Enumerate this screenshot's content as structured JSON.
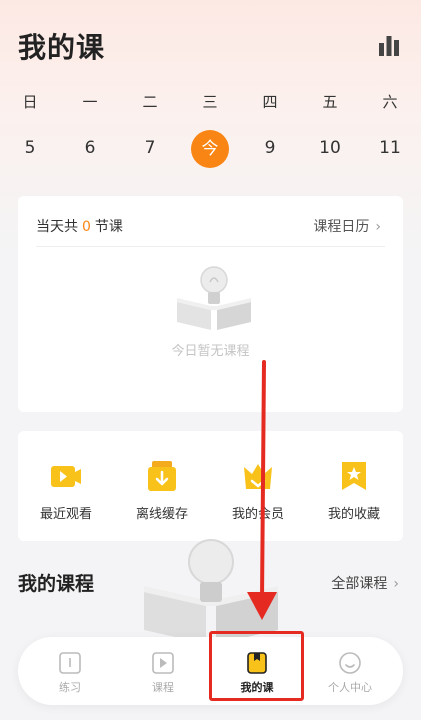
{
  "header": {
    "title": "我的课"
  },
  "calendar": {
    "weekdays": [
      "日",
      "一",
      "二",
      "三",
      "四",
      "五",
      "六"
    ],
    "dates": [
      "5",
      "6",
      "7",
      "今",
      "9",
      "10",
      "11"
    ]
  },
  "today_card": {
    "prefix": "当天共",
    "count": "0",
    "suffix": "节课",
    "calendar_link": "课程日历",
    "empty_text": "今日暂无课程"
  },
  "shortcuts": [
    {
      "label": "最近观看",
      "icon": "recent-video-icon"
    },
    {
      "label": "离线缓存",
      "icon": "offline-download-icon"
    },
    {
      "label": "我的会员",
      "icon": "membership-crown-icon"
    },
    {
      "label": "我的收藏",
      "icon": "favorite-star-icon"
    }
  ],
  "courses_section": {
    "title": "我的课程",
    "all_link": "全部课程"
  },
  "tabbar": [
    {
      "label": "练习",
      "icon": "practice-book-icon",
      "active": false
    },
    {
      "label": "课程",
      "icon": "course-play-icon",
      "active": false
    },
    {
      "label": "我的课",
      "icon": "my-course-icon",
      "active": true
    },
    {
      "label": "个人中心",
      "icon": "profile-face-icon",
      "active": false
    }
  ],
  "colors": {
    "accent": "#f98514",
    "icon_yellow": "#f8c21a",
    "annotation_red": "#e52b21"
  }
}
